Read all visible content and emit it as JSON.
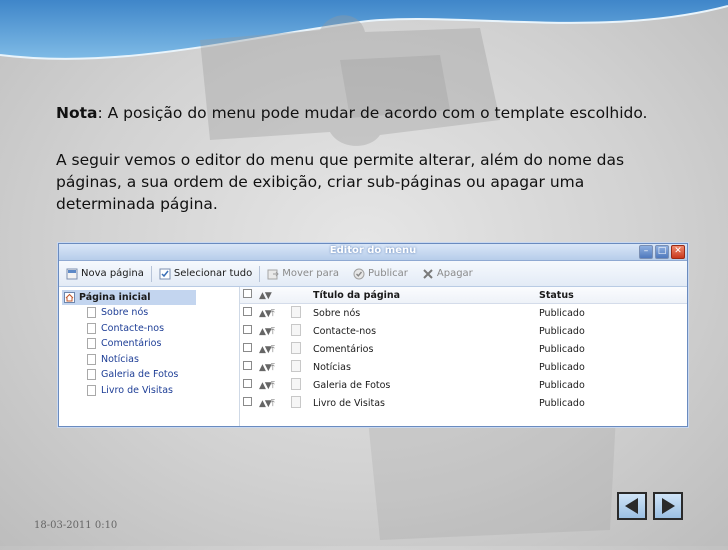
{
  "slide": {
    "note_label": "Nota",
    "note_text": ": A posição do menu pode mudar de acordo com o template escolhido.",
    "paragraph": "A seguir vemos o editor do menu que permite alterar, além do nome das páginas, a sua ordem de exibição, criar sub-páginas ou apagar uma determinada página.",
    "date": "18-03-2011 0:10"
  },
  "window": {
    "title": "Editor do menu",
    "toolbar": {
      "new_page": "Nova página",
      "select_all": "Selecionar tudo",
      "move_to": "Mover para",
      "publish": "Publicar",
      "delete": "Apagar"
    },
    "tree": {
      "root": "Página inicial",
      "items": [
        "Sobre nós",
        "Contacte-nos",
        "Comentários",
        "Notícias",
        "Galeria de Fotos",
        "Livro de Visitas"
      ]
    },
    "grid": {
      "col_title": "Título da página",
      "col_status": "Status",
      "rows": [
        {
          "title": "Sobre nós",
          "status": "Publicado"
        },
        {
          "title": "Contacte-nos",
          "status": "Publicado"
        },
        {
          "title": "Comentários",
          "status": "Publicado"
        },
        {
          "title": "Notícias",
          "status": "Publicado"
        },
        {
          "title": "Galeria de Fotos",
          "status": "Publicado"
        },
        {
          "title": "Livro de Visitas",
          "status": "Publicado"
        }
      ]
    }
  },
  "colors": {
    "accent_blue": "#4f8fcf",
    "link_blue": "#1e3e96"
  }
}
